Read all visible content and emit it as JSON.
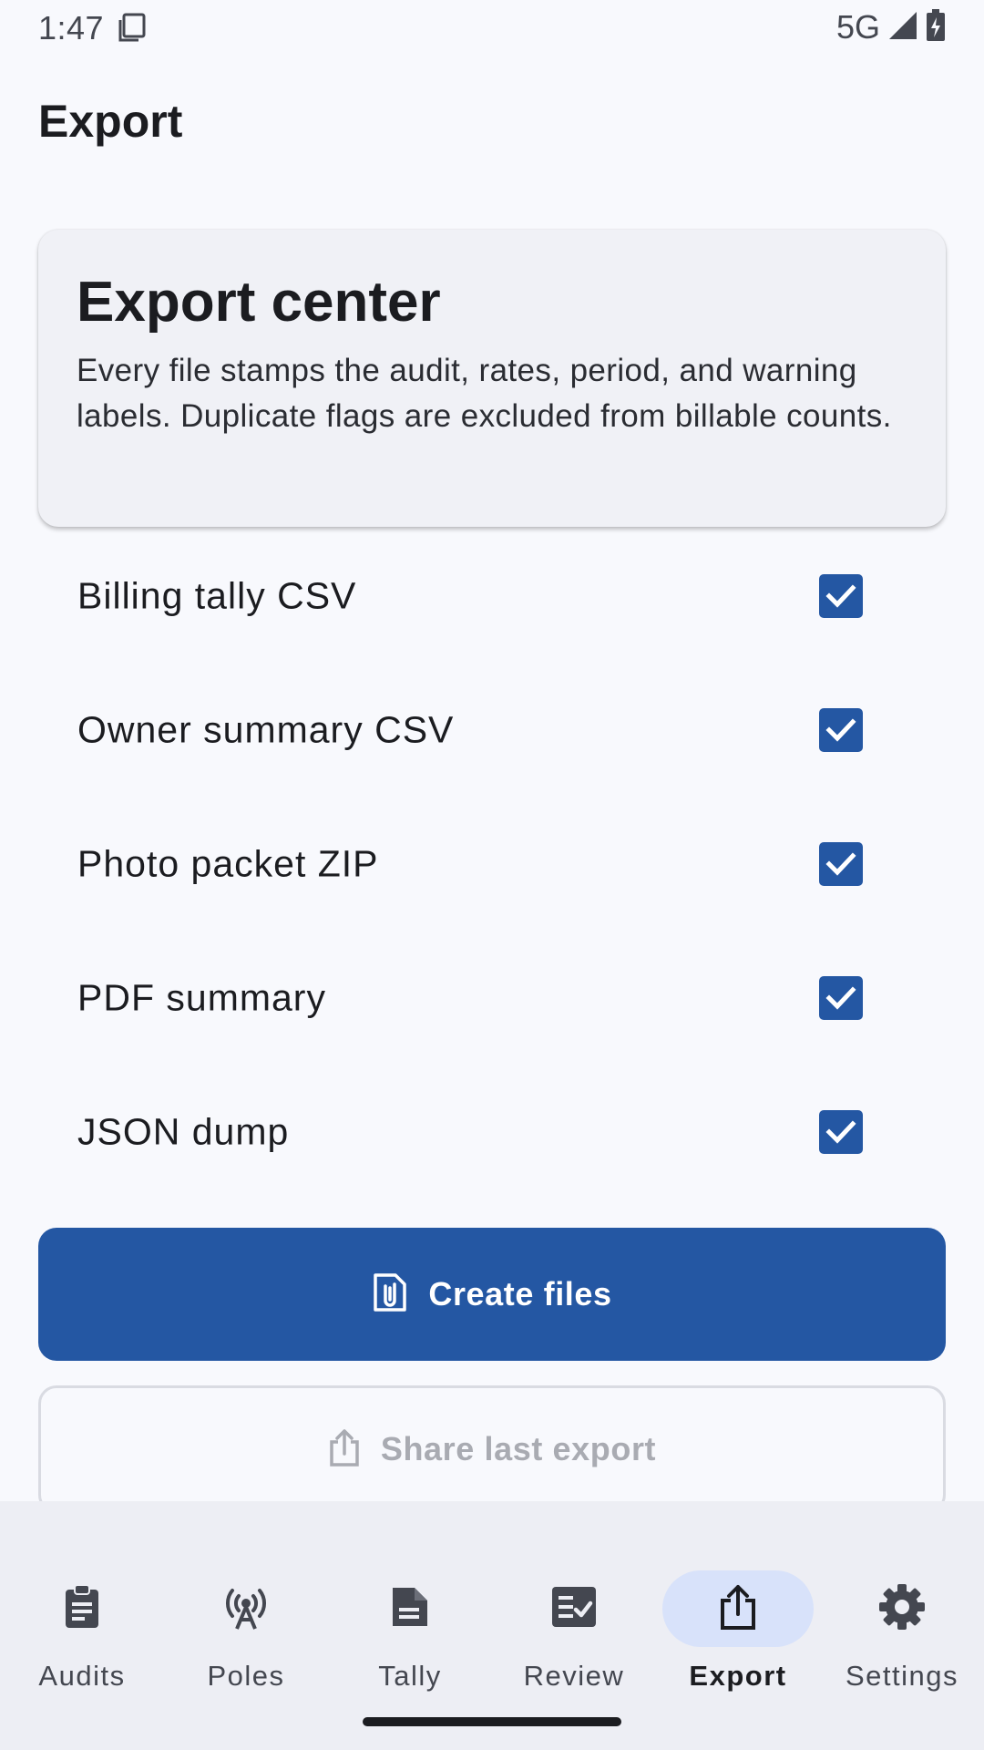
{
  "status_bar": {
    "time": "1:47",
    "network": "5G"
  },
  "header": {
    "title": "Export"
  },
  "info_card": {
    "title": "Export center",
    "description": "Every file stamps the audit, rates, period, and warning labels. Duplicate flags are excluded from billable counts."
  },
  "options": [
    {
      "label": "Billing tally CSV",
      "checked": true
    },
    {
      "label": "Owner summary CSV",
      "checked": true
    },
    {
      "label": "Photo packet ZIP",
      "checked": true
    },
    {
      "label": "PDF summary",
      "checked": true
    },
    {
      "label": "JSON dump",
      "checked": true
    }
  ],
  "actions": {
    "create_files_label": "Create files",
    "share_last_export_label": "Share last export"
  },
  "bottom_nav": {
    "items": [
      {
        "label": "Audits",
        "icon": "clipboard-icon"
      },
      {
        "label": "Poles",
        "icon": "antenna-icon"
      },
      {
        "label": "Tally",
        "icon": "note-icon"
      },
      {
        "label": "Review",
        "icon": "checklist-icon"
      },
      {
        "label": "Export",
        "icon": "share-icon",
        "active": true
      },
      {
        "label": "Settings",
        "icon": "gear-icon"
      }
    ]
  },
  "colors": {
    "primary": "#2457a3",
    "background": "#f8f9fd",
    "nav_background": "#edeef4",
    "active_pill": "#d8e2fa",
    "disabled_text": "#a9abb2"
  }
}
